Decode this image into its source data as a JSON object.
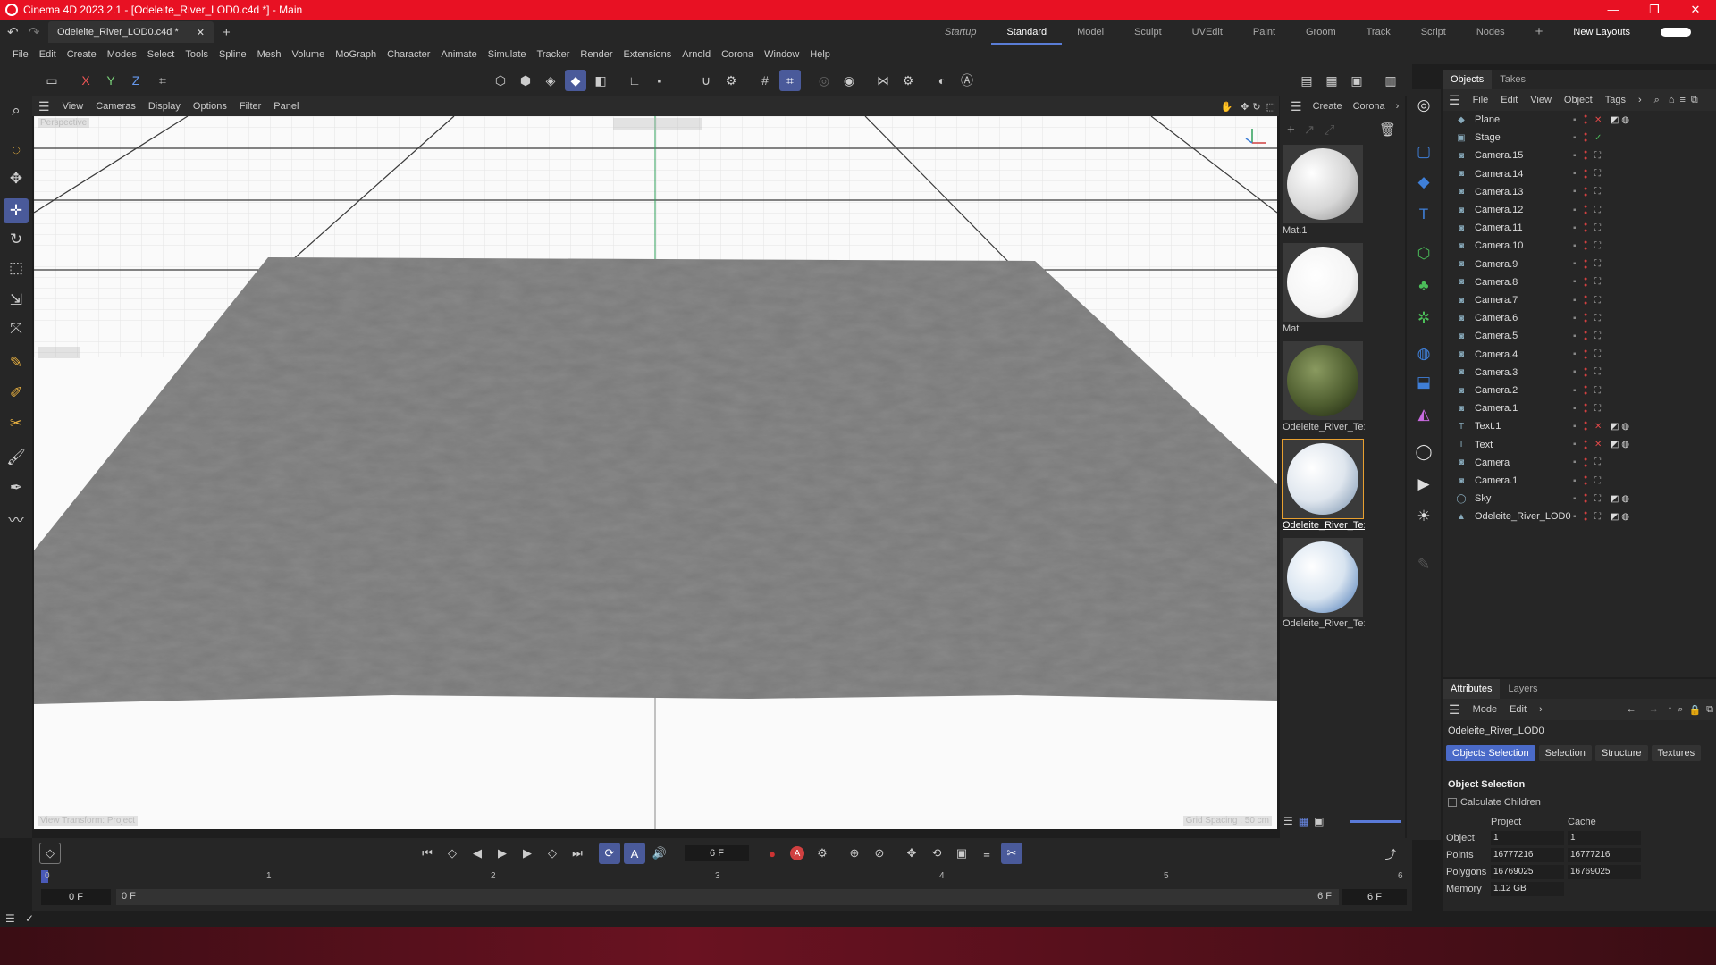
{
  "window": {
    "title": "Cinema 4D 2023.2.1 - [Odeleite_River_LOD0.c4d *] - Main",
    "min": "—",
    "max": "❐",
    "close": "✕"
  },
  "doc_tab": {
    "label": "Odeleite_River_LOD0.c4d *",
    "add": "+"
  },
  "layouts": [
    "Startup",
    "Standard",
    "Model",
    "Sculpt",
    "UVEdit",
    "Paint",
    "Groom",
    "Track",
    "Script",
    "Nodes"
  ],
  "new_layouts": "New Layouts",
  "menu": [
    "File",
    "Edit",
    "Create",
    "Modes",
    "Select",
    "Tools",
    "Spline",
    "Mesh",
    "Volume",
    "MoGraph",
    "Character",
    "Animate",
    "Simulate",
    "Tracker",
    "Render",
    "Extensions",
    "Arnold",
    "Corona",
    "Window",
    "Help"
  ],
  "axis": {
    "x": "X",
    "y": "Y",
    "z": "Z"
  },
  "viewport": {
    "menu": [
      "View",
      "Cameras",
      "Display",
      "Options",
      "Filter",
      "Panel"
    ],
    "camera_label": "Perspective",
    "view_transform": "View Transform: Project",
    "grid_spacing": "Grid Spacing : 50 cm",
    "colors": {
      "bg": "#fafafa",
      "terrain": "#7a7a7a",
      "grid": "#3a3a3a"
    }
  },
  "materials": {
    "menu": [
      "Create",
      "Corona"
    ],
    "items": [
      {
        "name": "Mat.1",
        "style": "white-matte"
      },
      {
        "name": "Mat",
        "style": "white-glossy"
      },
      {
        "name": "Odeleite_River_Te:",
        "style": "terrain-green"
      },
      {
        "name": "Odeleite_River_Te:",
        "style": "river-blue",
        "selected": true
      },
      {
        "name": "Odeleite_River_Te:",
        "style": "river-blue"
      }
    ]
  },
  "objects": {
    "tabs": [
      "Objects",
      "Takes"
    ],
    "menu": [
      "File",
      "Edit",
      "View",
      "Object",
      "Tags"
    ],
    "rows": [
      {
        "name": "Plane",
        "icon": "plane-icon",
        "status": "x",
        "tags": true
      },
      {
        "name": "Stage",
        "icon": "stage-icon",
        "status": "check",
        "tags": false
      },
      {
        "name": "Camera.15",
        "icon": "camera-icon",
        "status": "",
        "tags": false
      },
      {
        "name": "Camera.14",
        "icon": "camera-icon",
        "status": "",
        "tags": false
      },
      {
        "name": "Camera.13",
        "icon": "camera-icon",
        "status": "",
        "tags": false
      },
      {
        "name": "Camera.12",
        "icon": "camera-icon",
        "status": "",
        "tags": false
      },
      {
        "name": "Camera.11",
        "icon": "camera-icon",
        "status": "",
        "tags": false
      },
      {
        "name": "Camera.10",
        "icon": "camera-icon",
        "status": "",
        "tags": false
      },
      {
        "name": "Camera.9",
        "icon": "camera-icon",
        "status": "",
        "tags": false
      },
      {
        "name": "Camera.8",
        "icon": "camera-icon",
        "status": "",
        "tags": false
      },
      {
        "name": "Camera.7",
        "icon": "camera-icon",
        "status": "",
        "tags": false
      },
      {
        "name": "Camera.6",
        "icon": "camera-icon",
        "status": "",
        "tags": false
      },
      {
        "name": "Camera.5",
        "icon": "camera-icon",
        "status": "",
        "tags": false
      },
      {
        "name": "Camera.4",
        "icon": "camera-icon",
        "status": "",
        "tags": false
      },
      {
        "name": "Camera.3",
        "icon": "camera-icon",
        "status": "",
        "tags": false
      },
      {
        "name": "Camera.2",
        "icon": "camera-icon",
        "status": "",
        "tags": false
      },
      {
        "name": "Camera.1",
        "icon": "camera-icon",
        "status": "",
        "tags": false
      },
      {
        "name": "Text.1",
        "icon": "text-icon",
        "status": "x",
        "tags": true
      },
      {
        "name": "Text",
        "icon": "text-icon",
        "status": "x",
        "tags": true
      },
      {
        "name": "Camera",
        "icon": "camera-icon",
        "status": "",
        "tags": false
      },
      {
        "name": "Camera.1",
        "icon": "camera-icon",
        "status": "",
        "tags": false
      },
      {
        "name": "Sky",
        "icon": "sky-icon",
        "status": "",
        "tags": true
      },
      {
        "name": "Odeleite_River_LOD0",
        "icon": "mesh-icon",
        "status": "",
        "tags": true
      }
    ]
  },
  "attributes": {
    "tabs": [
      "Attributes",
      "Layers"
    ],
    "menu": [
      "Mode",
      "Edit"
    ],
    "object_name": "Odeleite_River_LOD0",
    "subtabs": [
      "Objects Selection",
      "Selection",
      "Structure",
      "Textures"
    ],
    "section": "Object Selection",
    "calc_children": "Calculate Children",
    "col_project": "Project",
    "col_cache": "Cache",
    "rows": [
      {
        "label": "Object",
        "project": "1",
        "cache": "1"
      },
      {
        "label": "Points",
        "project": "16777216",
        "cache": "16777216"
      },
      {
        "label": "Polygons",
        "project": "16769025",
        "cache": "16769025"
      },
      {
        "label": "Memory",
        "project": "1.12 GB",
        "cache": ""
      }
    ]
  },
  "timeline": {
    "current_frame": "6 F",
    "start": "0 F",
    "range_start": "0 F",
    "range_end": "6 F",
    "end": "6 F",
    "ticks": [
      "0",
      "1",
      "2",
      "3",
      "4",
      "5",
      "6"
    ]
  }
}
